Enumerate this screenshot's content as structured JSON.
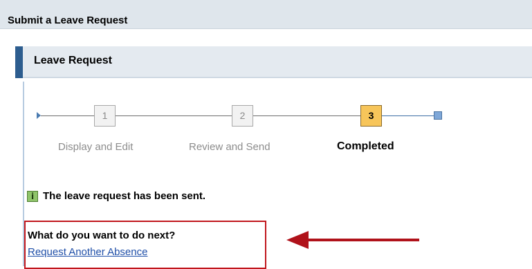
{
  "page": {
    "title": "Submit a Leave Request"
  },
  "panel": {
    "title": "Leave Request"
  },
  "roadmap": {
    "steps": [
      {
        "number": "1",
        "label": "Display and Edit",
        "state": "inactive"
      },
      {
        "number": "2",
        "label": "Review and Send",
        "state": "inactive"
      },
      {
        "number": "3",
        "label": "Completed",
        "state": "current"
      }
    ]
  },
  "message": {
    "icon": "info-icon",
    "icon_glyph": "i",
    "text": "The leave request has been sent."
  },
  "next": {
    "question": "What do you want to do next?",
    "link": "Request Another Absence"
  },
  "colors": {
    "current_step": "#f7c55a",
    "highlight_border": "#c0151b",
    "link": "#1f4fa8",
    "accent": "#2d5d8f"
  }
}
